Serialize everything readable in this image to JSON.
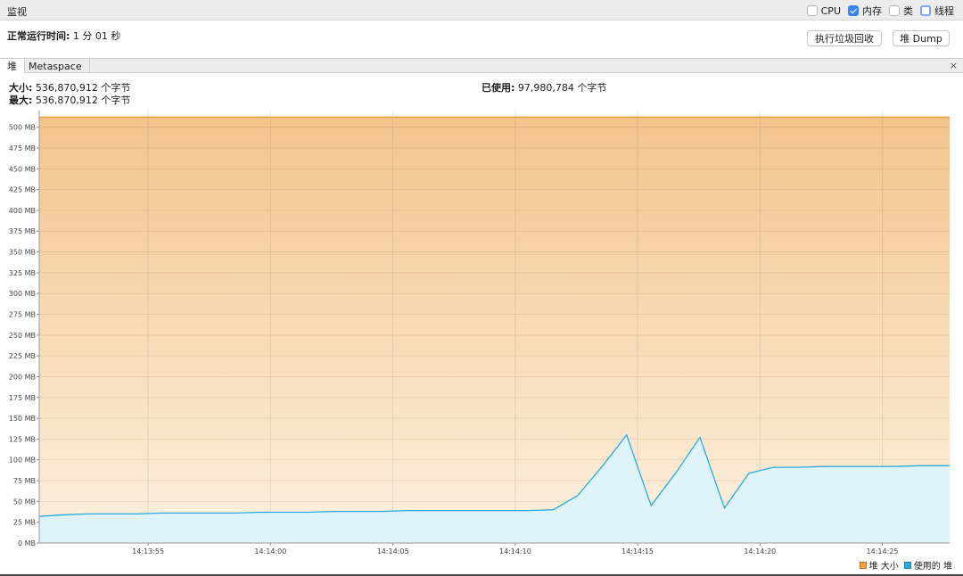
{
  "window": {
    "title": "监视"
  },
  "toggles": [
    {
      "label": "CPU",
      "checked": false,
      "name": "cpu"
    },
    {
      "label": "内存",
      "checked": true,
      "name": "memory"
    },
    {
      "label": "类",
      "checked": false,
      "name": "classes"
    },
    {
      "label": "线程",
      "checked": false,
      "name": "threads"
    }
  ],
  "uptime": {
    "label": "正常运行时间:",
    "value": "1 分 01 秒"
  },
  "buttons": {
    "gc": "执行垃圾回收",
    "heap_dump": "堆 Dump"
  },
  "tabs": [
    {
      "label": "堆"
    },
    {
      "label": "Metaspace"
    }
  ],
  "tab_close": "×",
  "stats": {
    "size_label": "大小:",
    "size_value": "536,870,912 个字节",
    "max_label": "最大:",
    "max_value": "536,870,912 个字节",
    "used_label": "已使用:",
    "used_value": "97,980,784 个字节"
  },
  "colors": {
    "size": "#f0a040",
    "used": "#29abe2"
  },
  "chart_data": {
    "type": "area",
    "ylim": [
      0,
      520
    ],
    "yticks": [
      0,
      25,
      50,
      75,
      100,
      125,
      150,
      175,
      200,
      225,
      250,
      275,
      300,
      325,
      350,
      375,
      400,
      425,
      450,
      475,
      500
    ],
    "ytick_labels": [
      "0 MB",
      "25 MB",
      "50 MB",
      "75 MB",
      "100 MB",
      "125 MB",
      "150 MB",
      "175 MB",
      "200 MB",
      "225 MB",
      "250 MB",
      "275 MB",
      "300 MB",
      "325 MB",
      "350 MB",
      "375 MB",
      "400 MB",
      "425 MB",
      "450 MB",
      "475 MB",
      "500 MB"
    ],
    "xlim": [
      0,
      37.2
    ],
    "xticks": [
      4.45,
      9.45,
      14.45,
      19.45,
      24.45,
      29.45,
      34.45
    ],
    "xtick_labels": [
      "14:13:55",
      "14:14:00",
      "14:14:05",
      "14:14:10",
      "14:14:15",
      "14:14:20",
      "14:14:25"
    ],
    "series": [
      {
        "name": "堆 大小",
        "color": "#f0a040",
        "x": [
          0,
          37.2
        ],
        "y": [
          512,
          512
        ]
      },
      {
        "name": "使用的 堆",
        "color": "#29abe2",
        "x": [
          0,
          1,
          2,
          3,
          4,
          5,
          6,
          7,
          8,
          9,
          10,
          11,
          12,
          13,
          14,
          15,
          16,
          17,
          18,
          19,
          20,
          21,
          22,
          23,
          24,
          25,
          26,
          27,
          28,
          29,
          30,
          31,
          32,
          33,
          34,
          35,
          36,
          37.2
        ],
        "y": [
          32,
          34,
          35,
          35,
          35,
          36,
          36,
          36,
          36,
          37,
          37,
          37,
          38,
          38,
          38,
          39,
          39,
          39,
          39,
          39,
          39,
          40,
          57,
          92,
          130,
          45,
          84,
          127,
          42,
          84,
          91,
          91,
          92,
          92,
          92,
          92,
          93,
          93
        ]
      }
    ]
  }
}
